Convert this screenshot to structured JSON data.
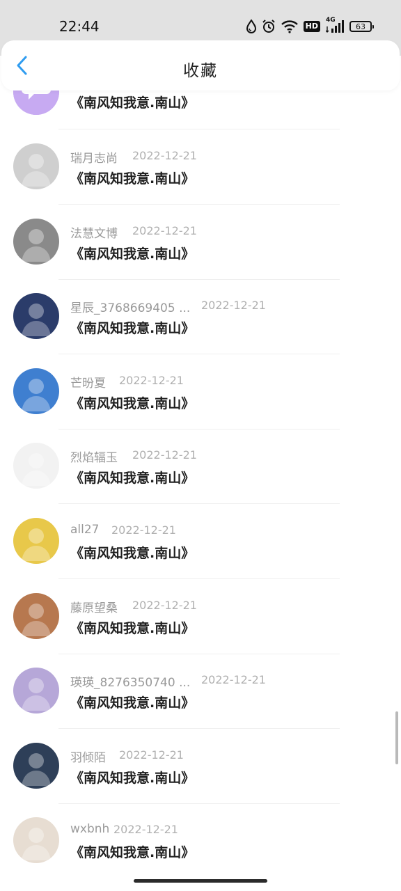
{
  "status_bar": {
    "time": "22:44",
    "battery": "63",
    "network": "4G",
    "hd": "HD",
    "icons": [
      "drop-icon",
      "alarm-icon",
      "wifi-icon",
      "hd-icon",
      "signal-icon",
      "battery-icon"
    ]
  },
  "header": {
    "title": "收藏",
    "back_icon": "chevron-left-icon",
    "accent_color": "#2f9cf0"
  },
  "list": {
    "partial_item": {
      "title": "《南风知我意.南山》"
    },
    "items": [
      {
        "name": "瑞月志尚",
        "date": "2022-12-21",
        "title": "《南风知我意.南山》",
        "avatar_color": "#cfcfcf"
      },
      {
        "name": "法慧文博",
        "date": "2022-12-21",
        "title": "《南风知我意.南山》",
        "avatar_color": "#8a8a8a"
      },
      {
        "name": "星辰_3768669405 ...",
        "date": "2022-12-21",
        "title": "《南风知我意.南山》",
        "avatar_color": "#2b3c6a"
      },
      {
        "name": "芒昐夏",
        "date": "2022-12-21",
        "title": "《南风知我意.南山》",
        "avatar_color": "#3f7fd0"
      },
      {
        "name": "烈焰辐玉",
        "date": "2022-12-21",
        "title": "《南风知我意.南山》",
        "avatar_color": "#f2f2f2"
      },
      {
        "name": "all27",
        "date": "2022-12-21",
        "title": "《南风知我意.南山》",
        "avatar_color": "#e8c84a"
      },
      {
        "name": "藤原望桑",
        "date": "2022-12-21",
        "title": "《南风知我意.南山》",
        "avatar_color": "#b7784f"
      },
      {
        "name": "瑛瑛_8276350740 ...",
        "date": "2022-12-21",
        "title": "《南风知我意.南山》",
        "avatar_color": "#b6a7d8"
      },
      {
        "name": "羽倾陌",
        "date": "2022-12-21",
        "title": "《南风知我意.南山》",
        "avatar_color": "#2e3f58"
      },
      {
        "name": "wxbnh",
        "date": "2022-12-21",
        "title": "《南风知我意.南山》",
        "avatar_color": "#e7ddd2"
      }
    ]
  }
}
